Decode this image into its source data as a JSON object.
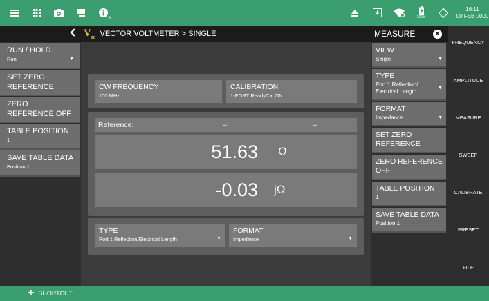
{
  "topbar": {
    "badge_count": "3",
    "battery_label": "100%",
    "time": "16:11",
    "date": "00 FEB 0000"
  },
  "left_panel": {
    "items": [
      {
        "title": "RUN / HOLD",
        "sub": "Run",
        "dropdown": true
      },
      {
        "title": "SET ZERO REFERENCE",
        "sub": ""
      },
      {
        "title": "ZERO REFERENCE OFF",
        "sub": ""
      },
      {
        "title": "TABLE POSITION",
        "sub": "1"
      },
      {
        "title": "SAVE TABLE DATA",
        "sub": "Position 1"
      }
    ]
  },
  "center": {
    "breadcrumb": "VECTOR VOLTMETER  >  SINGLE",
    "logo_letter": "V",
    "logo_sub": "m",
    "cw_frequency": {
      "label": "CW FREQUENCY",
      "value": "100 MHz"
    },
    "calibration": {
      "label": "CALIBRATION",
      "value": "1-PORT ReadyCal ON"
    },
    "reference": {
      "label": "Reference:",
      "v1": "--",
      "v2": "--"
    },
    "real": {
      "value": "51.63",
      "unit": "Ω"
    },
    "imag": {
      "value": "-0.03",
      "unit": "jΩ"
    },
    "type": {
      "label": "TYPE",
      "value": "Port 1 Reflection/Electrical Length"
    },
    "format": {
      "label": "FORMAT",
      "value": "Impedance"
    }
  },
  "right_panel": {
    "title": "MEASURE",
    "items": [
      {
        "title": "VIEW",
        "sub": "Single",
        "dropdown": true
      },
      {
        "title": "TYPE",
        "sub": "Port 1 Reflection/ Electrical Length",
        "dropdown": true
      },
      {
        "title": "FORMAT",
        "sub": "Impedance",
        "dropdown": true
      },
      {
        "title": "SET ZERO REFERENCE",
        "sub": ""
      },
      {
        "title": "ZERO REFERENCE OFF",
        "sub": ""
      },
      {
        "title": "TABLE POSITION",
        "sub": "1"
      },
      {
        "title": "SAVE TABLE DATA",
        "sub": "Position 1"
      }
    ]
  },
  "nav": [
    "FREQUENCY",
    "AMPLITUDE",
    "MEASURE",
    "SWEEP",
    "CALIBRATE",
    "PRESET",
    "FILE"
  ],
  "bottombar": {
    "shortcut": "SHORTCUT"
  },
  "colors": {
    "accent": "#3a9e71",
    "panel": "#6d6d6d",
    "field": "#7a7a7a"
  }
}
